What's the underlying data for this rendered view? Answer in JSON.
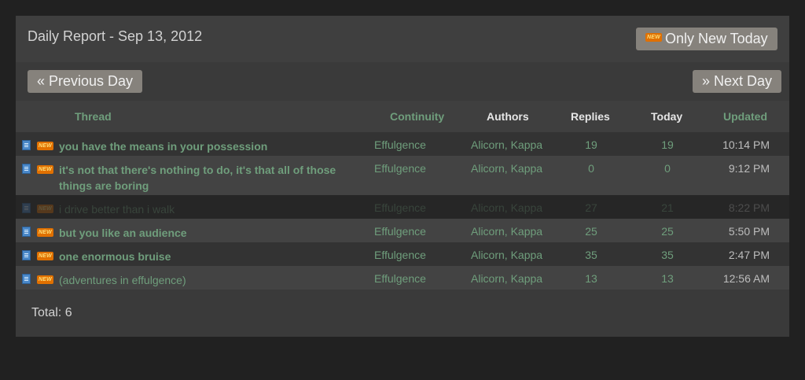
{
  "header": {
    "title": "Daily Report - Sep 13, 2012",
    "only_new_label": "Only New Today",
    "new_badge": "NEW"
  },
  "nav": {
    "prev_label": "« Previous Day",
    "next_label": "» Next Day"
  },
  "table": {
    "columns": {
      "thread": "Thread",
      "continuity": "Continuity",
      "authors": "Authors",
      "replies": "Replies",
      "today": "Today",
      "updated": "Updated"
    },
    "rows": [
      {
        "thread": "you have the means in your possession",
        "continuity": "Effulgence",
        "authors": "Alicorn, Kappa",
        "replies": "19",
        "today": "19",
        "updated": "10:14 PM",
        "style": "bold"
      },
      {
        "thread": "it's not that there's nothing to do, it's that all of those things are boring",
        "continuity": "Effulgence",
        "authors": "Alicorn, Kappa",
        "replies": "0",
        "today": "0",
        "updated": "9:12 PM",
        "style": "bold"
      },
      {
        "thread": "i drive better than i walk",
        "continuity": "Effulgence",
        "authors": "Alicorn, Kappa",
        "replies": "27",
        "today": "21",
        "updated": "8:22 PM",
        "style": "faded"
      },
      {
        "thread": "but you like an audience",
        "continuity": "Effulgence",
        "authors": "Alicorn, Kappa",
        "replies": "25",
        "today": "25",
        "updated": "5:50 PM",
        "style": "bold"
      },
      {
        "thread": "one enormous bruise",
        "continuity": "Effulgence",
        "authors": "Alicorn, Kappa",
        "replies": "35",
        "today": "35",
        "updated": "2:47 PM",
        "style": "bold"
      },
      {
        "thread": "(adventures in effulgence)",
        "continuity": "Effulgence",
        "authors": "Alicorn, Kappa",
        "replies": "13",
        "today": "13",
        "updated": "12:56 AM",
        "style": "normal"
      }
    ]
  },
  "footer": {
    "total": "Total: 6"
  },
  "colors": {
    "link": "#6f9e7c",
    "button": "#86827c",
    "badge": "#e07000"
  }
}
